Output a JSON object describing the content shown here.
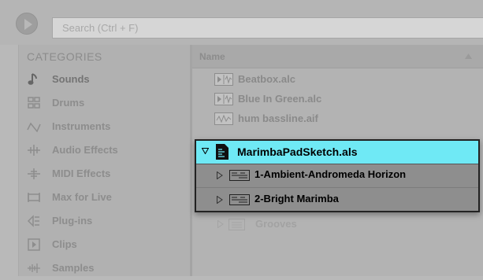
{
  "search": {
    "placeholder": "Search (Ctrl + F)"
  },
  "sidebar": {
    "header": "CATEGORIES",
    "items": [
      {
        "label": "Sounds",
        "icon": "note-icon"
      },
      {
        "label": "Drums",
        "icon": "drum-pads-icon"
      },
      {
        "label": "Instruments",
        "icon": "waveform-icon"
      },
      {
        "label": "Audio Effects",
        "icon": "audio-effects-icon"
      },
      {
        "label": "MIDI Effects",
        "icon": "midi-effects-icon"
      },
      {
        "label": "Max for Live",
        "icon": "max-for-live-icon"
      },
      {
        "label": "Plug-ins",
        "icon": "plugin-icon"
      },
      {
        "label": "Clips",
        "icon": "clip-icon"
      },
      {
        "label": "Samples",
        "icon": "samples-icon"
      }
    ]
  },
  "browser": {
    "column_header": "Name",
    "files": [
      {
        "label": "Beatbox.alc",
        "icon": "clip-file-icon"
      },
      {
        "label": "Blue In Green.alc",
        "icon": "clip-file-icon"
      },
      {
        "label": "hum bassline.aif",
        "icon": "audio-file-icon"
      }
    ],
    "faded_item": {
      "label": "Grooves",
      "icon": "folder-icon"
    }
  },
  "popout": {
    "title": "MarimbaPadSketch.als",
    "tracks": [
      {
        "label": "1-Ambient-Andromeda Horizon"
      },
      {
        "label": "2-Bright Marimba"
      }
    ]
  },
  "colors": {
    "highlight": "#6fe9f5",
    "panel": "#b3b3b3",
    "popout_bg": "#8e8e8e"
  }
}
